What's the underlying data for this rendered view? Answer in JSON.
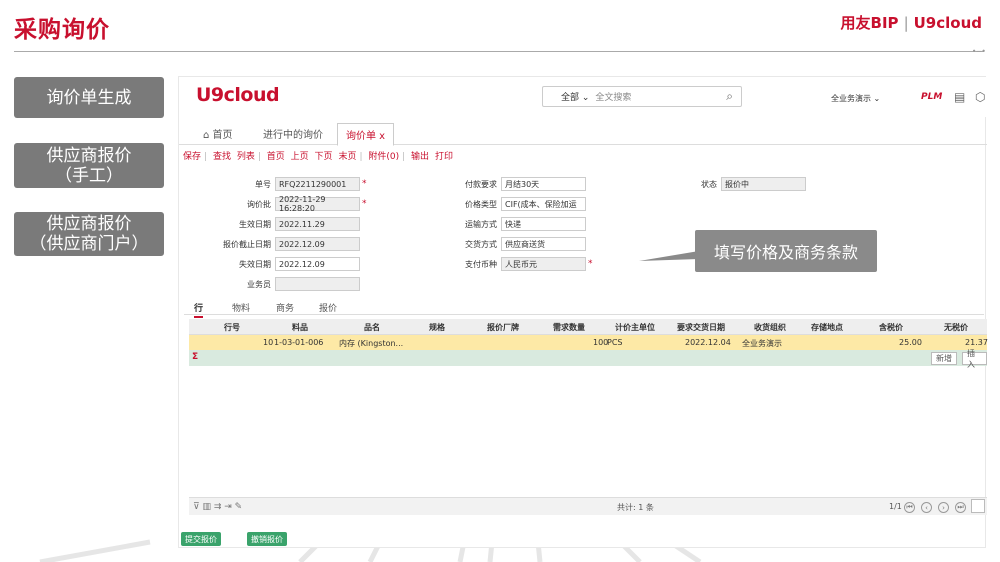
{
  "slide": {
    "title": "采购询价",
    "brand_left": "用友BIP",
    "brand_sep": "|",
    "brand_right": "U9cloud",
    "steps": [
      "询价单生成",
      "供应商报价",
      "（手工）",
      "供应商报价",
      "（供应商门户）"
    ]
  },
  "app": {
    "logo": "U9cloud",
    "search_scope": "全部 ⌄",
    "search_placeholder": "全文搜索",
    "org": "全业务演示 ⌄",
    "plm": "PLM",
    "tabs": [
      "首页",
      "进行中的询价",
      "询价单 x"
    ],
    "toolbar": [
      "保存",
      "查找",
      "列表",
      "首页",
      "上页",
      "下页",
      "末页",
      "附件(0)",
      "输出",
      "打印"
    ],
    "form": {
      "left": [
        {
          "label": "单号",
          "value": "RFQ2211290001"
        },
        {
          "label": "询价批",
          "value": "2022-11-29 16:28:20"
        },
        {
          "label": "生效日期",
          "value": "2022.11.29"
        },
        {
          "label": "报价截止日期",
          "value": "2022.12.09"
        },
        {
          "label": "失效日期",
          "value": "2022.12.09"
        },
        {
          "label": "业务员",
          "value": ""
        }
      ],
      "mid": [
        {
          "label": "付款要求",
          "value": "月结30天"
        },
        {
          "label": "价格类型",
          "value": "CIF(成本、保险加运"
        },
        {
          "label": "运输方式",
          "value": "快递"
        },
        {
          "label": "交货方式",
          "value": "供应商送货"
        },
        {
          "label": "支付币种",
          "value": "人民币元"
        }
      ],
      "status_label": "状态",
      "status_value": "报价中"
    },
    "callout": "填写价格及商务条款",
    "subtabs": [
      "行",
      "物料",
      "商务",
      "报价"
    ],
    "grid": {
      "headers": [
        "行号",
        "料品",
        "品名",
        "规格",
        "报价厂牌",
        "需求数量",
        "计价主单位",
        "要求交货日期",
        "收货组织",
        "存储地点",
        "含税价",
        "无税价"
      ],
      "row": [
        "10",
        "1-03-01-006",
        "内存 (Kingston...",
        "",
        "",
        "100",
        "PCS",
        "2022.12.04",
        "全业务演示",
        "",
        "25.00",
        "21.37"
      ],
      "sum_symbol": "Σ",
      "btn_add": "新增",
      "btn_insert": "插入"
    },
    "footer": {
      "total": "共计: 1 条",
      "page": "1/1"
    },
    "buttons": [
      "提交报价",
      "撤销报价"
    ]
  }
}
